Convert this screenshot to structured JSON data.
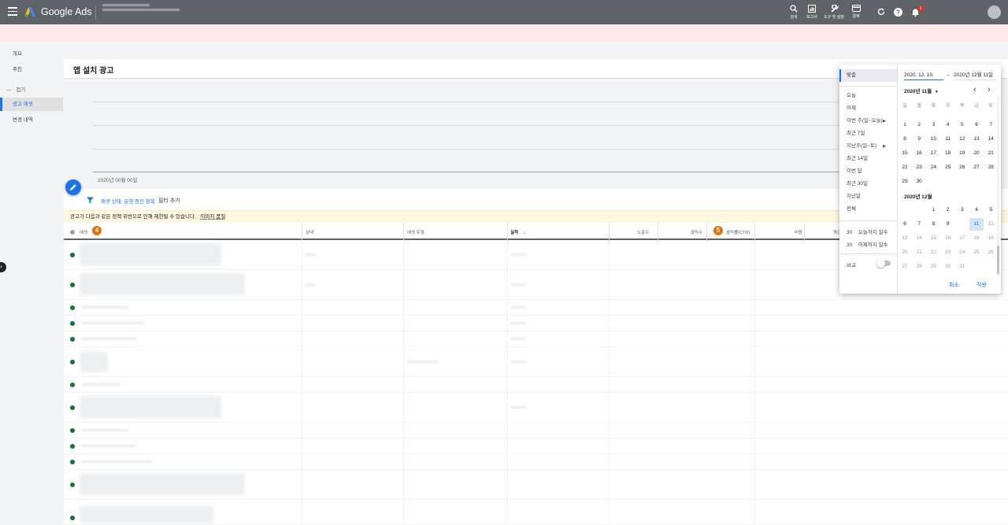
{
  "topbar": {
    "brand": "Google Ads",
    "tools": [
      {
        "label": "검색",
        "icon": "search-icon"
      },
      {
        "label": "보고서",
        "icon": "reports-icon"
      },
      {
        "label": "도구 및 설정",
        "icon": "wrench-icon"
      },
      {
        "label": "결제",
        "icon": "billing-icon"
      }
    ],
    "notification_count": "1"
  },
  "sidebar": {
    "items": [
      {
        "label": "개요"
      },
      {
        "label": "추천"
      },
      {
        "label": "접기"
      },
      {
        "label": "광고 애셋"
      },
      {
        "label": "변경 내역"
      }
    ]
  },
  "main": {
    "title": "앱 설치 광고",
    "chart_tick": "2020년 00월 00일",
    "filter_chip": "애셋 상태: 운영 중인 항목",
    "filter_add": "필터 추가",
    "warning_text": "광고가 다음과 같은 정책 위반으로 인해 제한될 수 있습니다.",
    "warning_link": "이미지 품질",
    "columns": [
      "애셋",
      "상태",
      "애셋 유형",
      "실적",
      "노출수",
      "클릭수",
      "클릭률(CTR)",
      "비용",
      "평균"
    ],
    "badges": [
      "4",
      "5"
    ]
  },
  "datepicker": {
    "presets": [
      "맞춤",
      "오늘",
      "어제",
      "이번 주(일~오늘)",
      "최근 7일",
      "지난주(일~토)",
      "최근 14일",
      "이번 달",
      "최근 30일",
      "지난달",
      "전체"
    ],
    "days_until_today": {
      "num": "30",
      "label": "오늘까지 일수"
    },
    "days_until_yesterday": {
      "num": "30",
      "label": "어제까지 일수"
    },
    "compare_label": "비교",
    "start_date": "2020. 12. 10.",
    "end_date": "2020년 12월 11일",
    "month1_label": "2020년 11월",
    "month2_label": "2020년 12월",
    "weekdays": [
      "일",
      "월",
      "화",
      "수",
      "목",
      "금",
      "토"
    ],
    "nov_weeks": [
      [
        "1",
        "2",
        "3",
        "4",
        "5",
        "6",
        "7"
      ],
      [
        "8",
        "9",
        "10",
        "11",
        "12",
        "13",
        "14"
      ],
      [
        "15",
        "16",
        "17",
        "18",
        "19",
        "20",
        "21"
      ],
      [
        "22",
        "23",
        "24",
        "25",
        "26",
        "27",
        "28"
      ],
      [
        "29",
        "30",
        "",
        "",
        "",
        "",
        ""
      ]
    ],
    "dec_weeks": [
      [
        "",
        "",
        "1",
        "2",
        "3",
        "4",
        "5"
      ],
      [
        "6",
        "7",
        "8",
        "9",
        "10",
        "11",
        "12"
      ],
      [
        "13",
        "14",
        "15",
        "16",
        "17",
        "18",
        "19"
      ],
      [
        "20",
        "21",
        "22",
        "23",
        "24",
        "25",
        "26"
      ],
      [
        "27",
        "28",
        "29",
        "30",
        "31",
        "",
        ""
      ]
    ],
    "selected_start": "10",
    "selected_end": "11",
    "cancel_label": "취소",
    "apply_label": "적용"
  }
}
